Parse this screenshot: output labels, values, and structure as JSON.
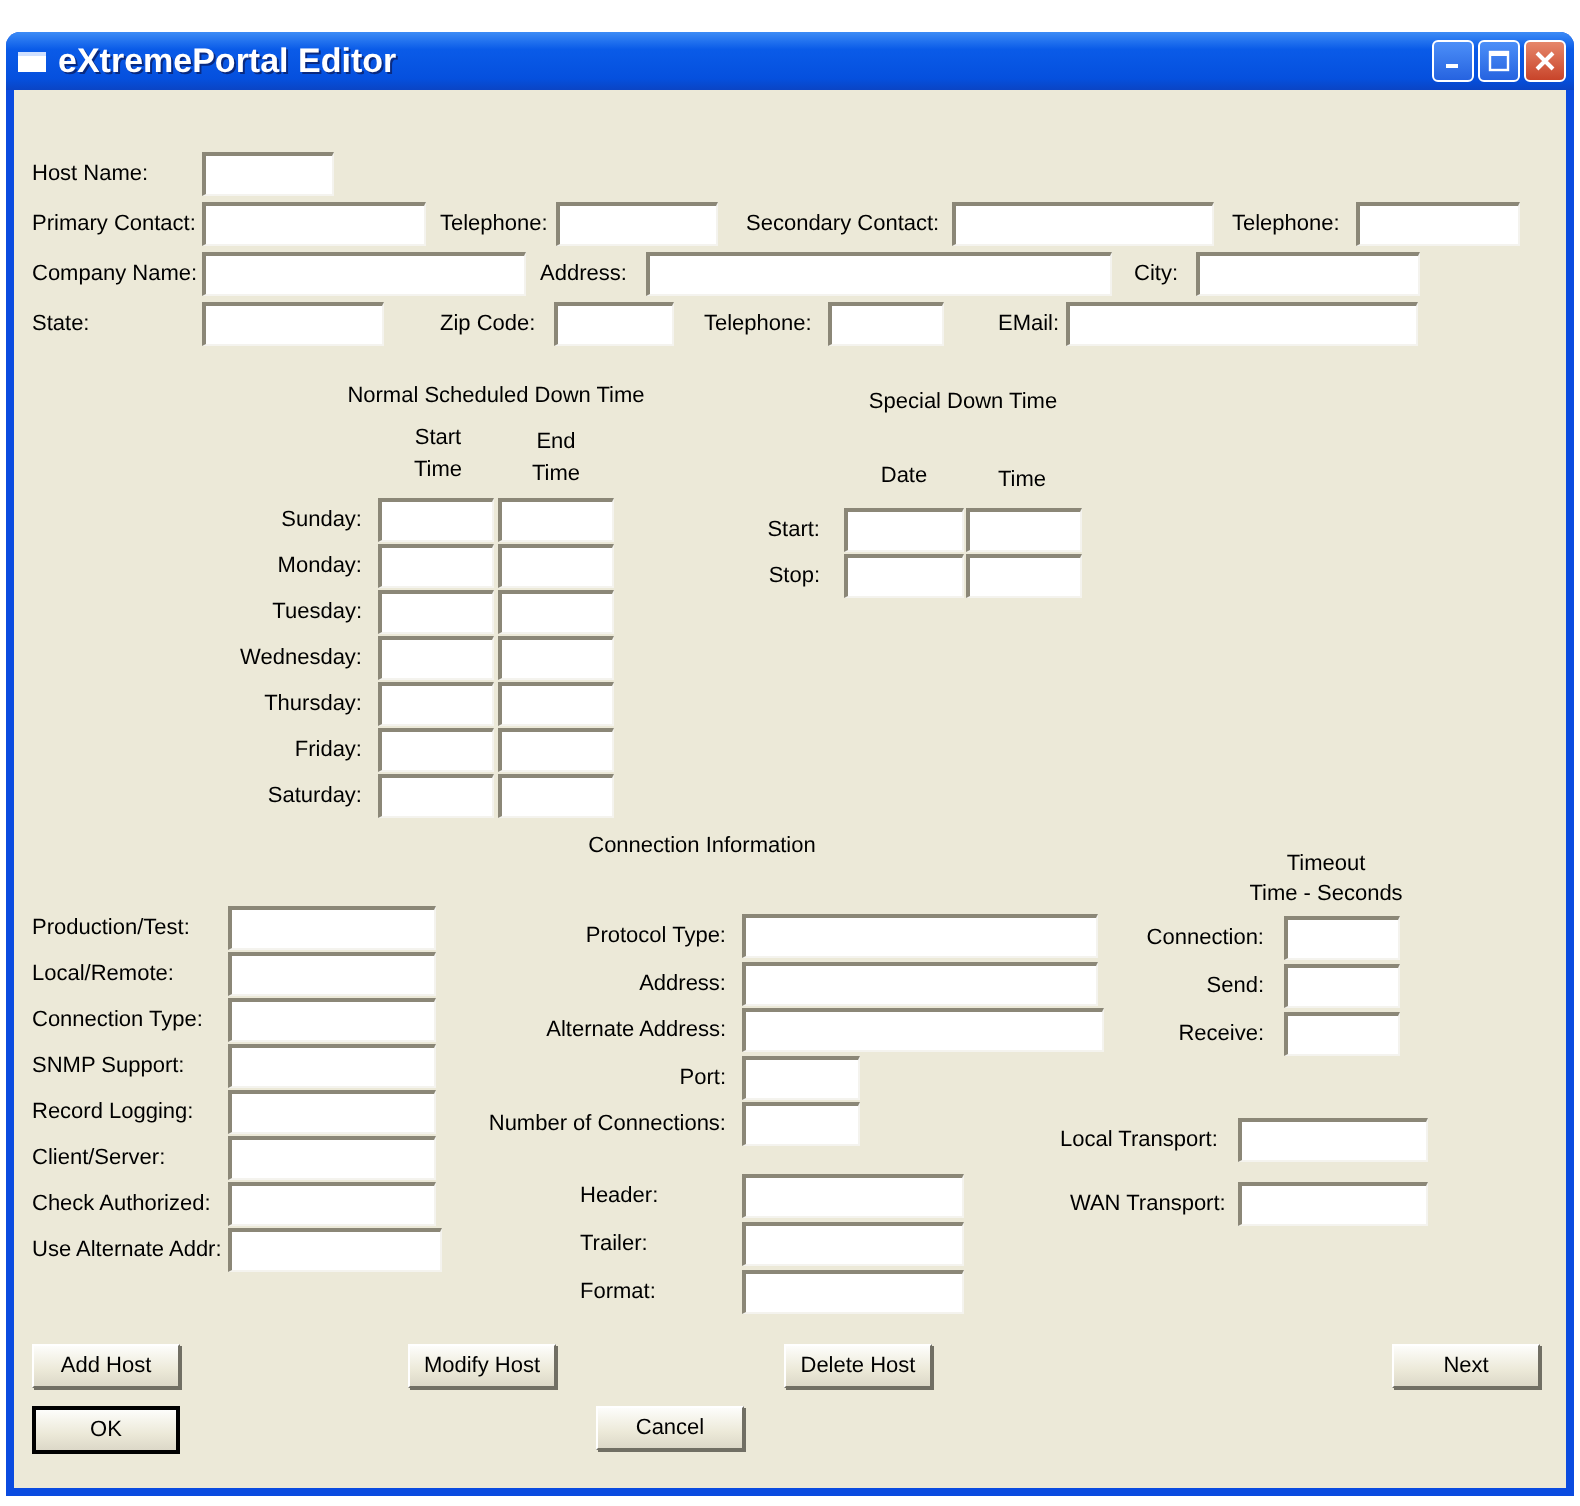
{
  "window": {
    "title": "eXtremePortal Editor"
  },
  "host_info": {
    "rows": [
      [
        {
          "label": "Host Name:"
        }
      ],
      [
        {
          "label": "Primary Contact:"
        },
        {
          "label": "Telephone:"
        },
        {
          "label": "Secondary Contact:"
        },
        {
          "label": "Telephone:"
        }
      ],
      [
        {
          "label": "Company Name:"
        },
        {
          "label": "Address:"
        },
        {
          "label": "City:"
        }
      ],
      [
        {
          "label": "State:"
        },
        {
          "label": "Zip Code:"
        },
        {
          "label": "Telephone:"
        },
        {
          "label": "EMail:"
        }
      ]
    ]
  },
  "scheduled_down_time": {
    "title": "Normal Scheduled Down Time",
    "columns": [
      "Start Time",
      "End Time"
    ],
    "rows": [
      "Sunday:",
      "Monday:",
      "Tuesday:",
      "Wednesday:",
      "Thursday:",
      "Friday:",
      "Saturday:"
    ]
  },
  "special_down_time": {
    "title": "Special Down Time",
    "columns": [
      "Date",
      "Time"
    ],
    "rows": [
      "Start:",
      "Stop:"
    ]
  },
  "connection_information": {
    "title": "Connection Information",
    "general_fields": [
      "Production/Test:",
      "Local/Remote:",
      "Connection Type:",
      "SNMP Support:",
      "Record Logging:",
      "Client/Server:",
      "Check Authorized:",
      "Use Alternate Addr:"
    ],
    "protocol_fields": [
      "Protocol Type:",
      "Address:",
      "Alternate Address:",
      "Port:",
      "Number of Connections:"
    ],
    "framing_fields": [
      "Header:",
      "Trailer:",
      "Format:"
    ]
  },
  "timeout": {
    "title_lines": [
      "Timeout",
      "Time - Seconds"
    ],
    "fields": [
      "Connection:",
      "Send:",
      "Receive:"
    ]
  },
  "transport_fields": [
    "Local Transport:",
    "WAN Transport:"
  ],
  "buttons": [
    [
      {
        "label": "Add Host",
        "default": false
      },
      {
        "label": "Modify Host",
        "default": false
      },
      {
        "label": "Delete Host",
        "default": false
      },
      {
        "label": "Next",
        "default": false
      }
    ],
    [
      {
        "label": "OK",
        "default": true
      },
      {
        "label": "Cancel",
        "default": false
      }
    ]
  ]
}
